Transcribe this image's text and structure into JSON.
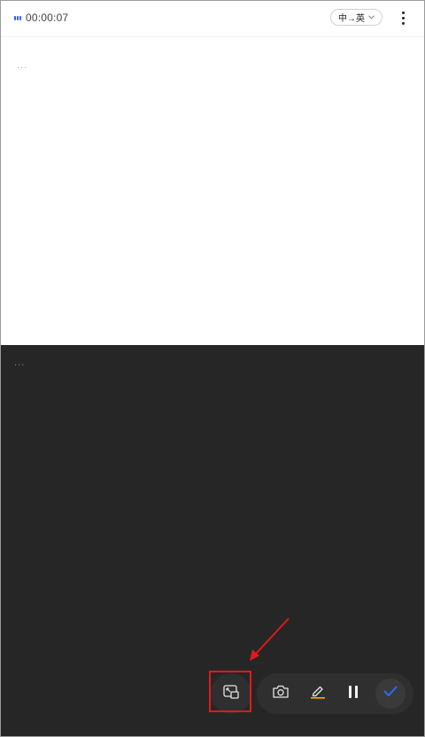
{
  "topbar": {
    "timer": "00:00:07",
    "recording_indicator_color": "#2b5cff",
    "language_pair": "中→英",
    "language_dropdown_icon": "chevron-down-icon",
    "more_icon": "more-vertical-icon"
  },
  "source_pane": {
    "placeholder": "..."
  },
  "translation_pane": {
    "placeholder": "...",
    "background": "#262626"
  },
  "floating_window_button": {
    "icon": "picture-in-picture-icon"
  },
  "toolbar": {
    "camera_icon": "camera-icon",
    "highlight_icon": "highlighter-icon",
    "highlight_accent": "#f2b100",
    "pause_icon": "pause-icon",
    "confirm_icon": "check-icon",
    "confirm_color": "#2b6cf6"
  },
  "annotation": {
    "highlight_color": "#e21a1a"
  }
}
